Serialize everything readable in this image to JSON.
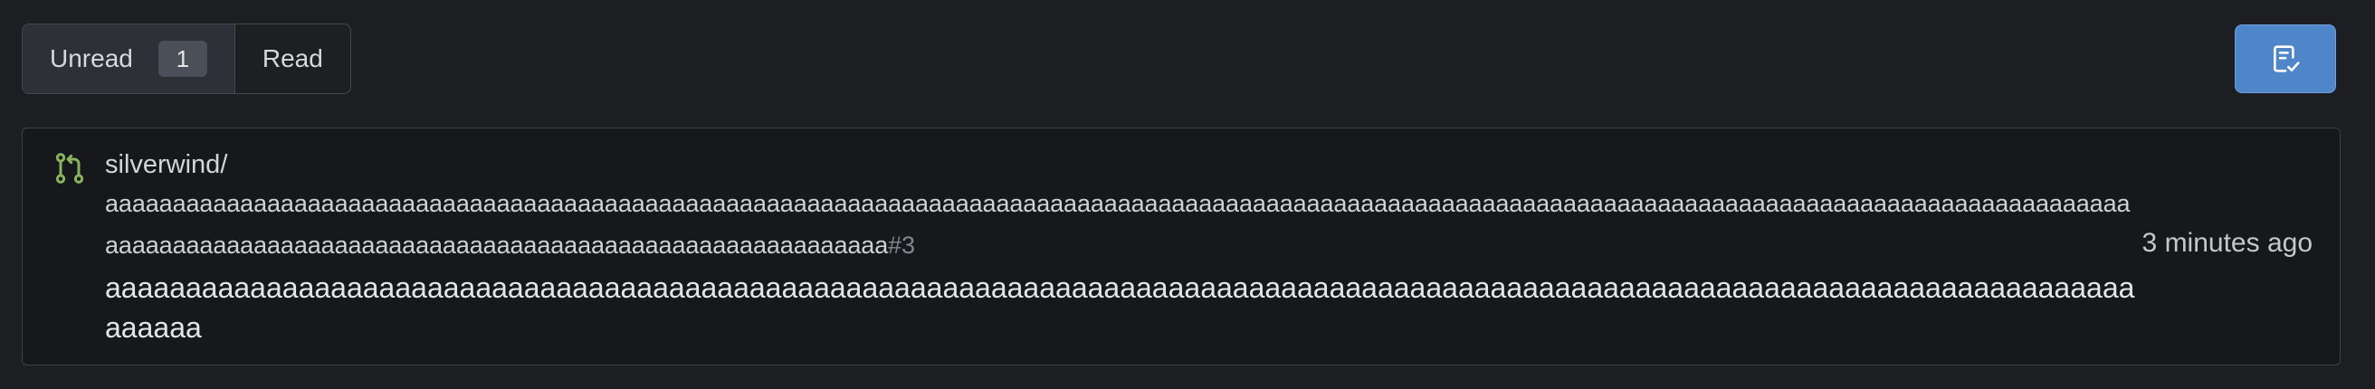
{
  "filters": {
    "unread_label": "Unread",
    "unread_count": "1",
    "read_label": "Read"
  },
  "actions": {
    "mark_all_read_icon": "clipboard-check-icon"
  },
  "notification": {
    "type_icon": "git-pull-request-icon",
    "repo_owner": "silverwind/",
    "repo_name": "aaaaaaaaaaaaaaaaaaaaaaaaaaaaaaaaaaaaaaaaaaaaaaaaaaaaaaaaaaaaaaaaaaaaaaaaaaaaaaaaaaaaaaaaaaaaaaaaaaaaaaaaaaaaaaaaaaaaaaaaaaaaaaaaaaaaaaaaaaaaaaaaaaaaaaaaaaaaaaaaaaaaaaaaaaaaaaaaaaaaaaaaaaaaaaaaaaaaaaaaaaaaaaaa",
    "issue_number": "#3",
    "title": "aaaaaaaaaaaaaaaaaaaaaaaaaaaaaaaaaaaaaaaaaaaaaaaaaaaaaaaaaaaaaaaaaaaaaaaaaaaaaaaaaaaaaaaaaaaaaaaaaaaaaaaaaaaaaaaaaaaaaaaaaaaaaaaaaaaa",
    "time": "3 minutes ago"
  },
  "colors": {
    "accent": "#4e86c9",
    "pr_icon": "#8ab360",
    "background": "#1c1e21"
  }
}
